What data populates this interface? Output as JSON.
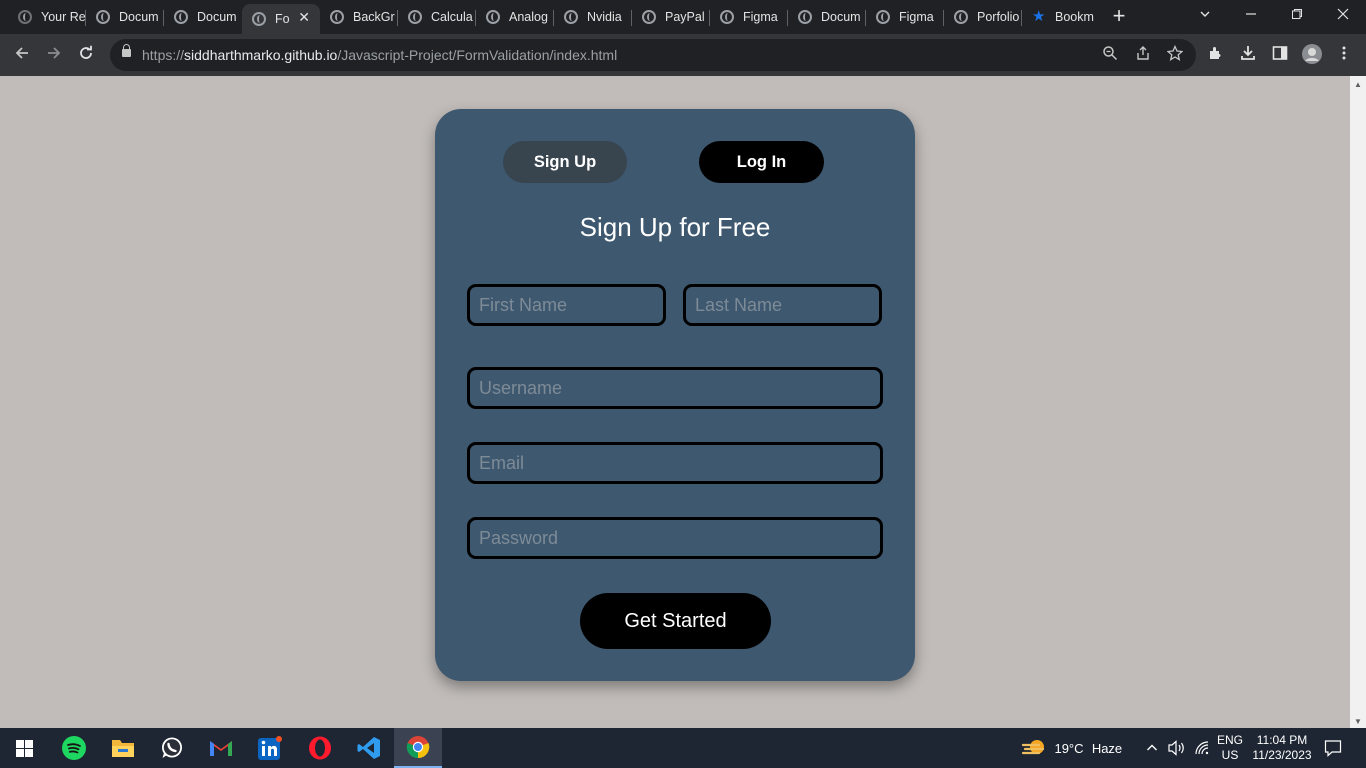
{
  "browser": {
    "tabs": [
      {
        "label": "Your Re",
        "icon": "github-icon",
        "active": false
      },
      {
        "label": "Docum",
        "icon": "globe-icon",
        "active": false
      },
      {
        "label": "Docum",
        "icon": "globe-icon",
        "active": false
      },
      {
        "label": "Fo",
        "icon": "globe-icon",
        "active": true
      },
      {
        "label": "BackGr",
        "icon": "globe-icon",
        "active": false
      },
      {
        "label": "Calcula",
        "icon": "globe-icon",
        "active": false
      },
      {
        "label": "Analog",
        "icon": "globe-icon",
        "active": false
      },
      {
        "label": "Nvidia",
        "icon": "globe-icon",
        "active": false
      },
      {
        "label": "PayPal",
        "icon": "globe-icon",
        "active": false
      },
      {
        "label": "Figma",
        "icon": "globe-icon",
        "active": false
      },
      {
        "label": "Docum",
        "icon": "globe-icon",
        "active": false
      },
      {
        "label": "Figma",
        "icon": "globe-icon",
        "active": false
      },
      {
        "label": "Porfolio",
        "icon": "globe-icon",
        "active": false
      },
      {
        "label": "Bookm",
        "icon": "star-icon",
        "active": false
      }
    ],
    "new_tab_symbol": "+",
    "url_scheme": "https://",
    "url_host": "siddharthmarko.github.io",
    "url_path": "/Javascript-Project/FormValidation/index.html"
  },
  "form": {
    "signup_toggle": "Sign Up",
    "login_toggle": "Log In",
    "title": "Sign Up for Free",
    "first_name_placeholder": "First Name",
    "last_name_placeholder": "Last Name",
    "username_placeholder": "Username",
    "email_placeholder": "Email",
    "password_placeholder": "Password",
    "submit_label": "Get Started",
    "colors": {
      "card": "#3e586f",
      "page_background": "#c1bcb9",
      "active_toggle": "#38444e",
      "button": "#000000"
    }
  },
  "taskbar": {
    "apps": [
      "start-icon",
      "spotify-icon",
      "file-explorer-icon",
      "whatsapp-icon",
      "gmail-icon",
      "linkedin-icon",
      "opera-icon",
      "vscode-icon",
      "chrome-icon"
    ],
    "weather_temp": "19°C",
    "weather_desc": "Haze",
    "lang": "ENG",
    "region": "US",
    "time": "11:04 PM",
    "date": "11/23/2023"
  }
}
